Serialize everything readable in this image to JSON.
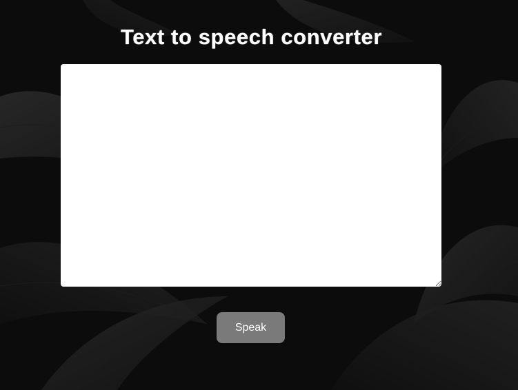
{
  "page": {
    "title": "Text to speech converter"
  },
  "editor": {
    "value": "",
    "placeholder": ""
  },
  "actions": {
    "speak_label": "Speak"
  },
  "theme": {
    "background": "#0d0d0d",
    "panel": "#ffffff",
    "button": "#7a7a7a",
    "title_text": "#ffffff"
  }
}
